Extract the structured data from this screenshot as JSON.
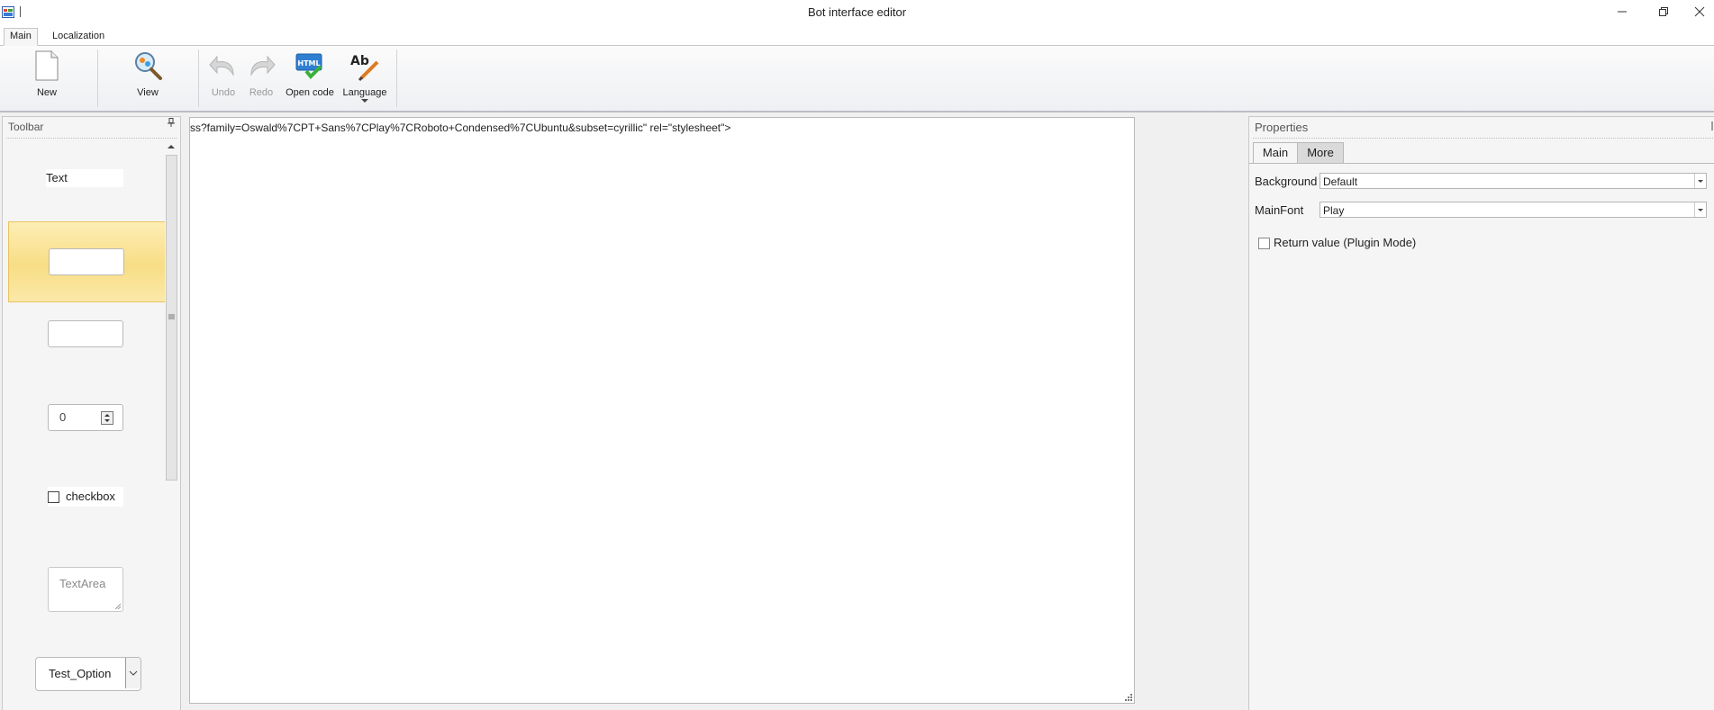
{
  "window": {
    "title": "Bot interface editor"
  },
  "ribbon_tabs": [
    {
      "label": "Main"
    },
    {
      "label": "Localization"
    }
  ],
  "ribbon": {
    "new_label": "New",
    "view_label": "View",
    "undo_label": "Undo",
    "redo_label": "Redo",
    "open_code_label": "Open code",
    "language_label": "Language"
  },
  "toolbar_panel": {
    "title": "Toolbar",
    "items": {
      "text_label": "Text",
      "number_value": "0",
      "checkbox_label": "checkbox",
      "textarea_placeholder": "TextArea",
      "select_value": "Test_Option"
    }
  },
  "editor": {
    "code_line": "ss?family=Oswald%7CPT+Sans%7CPlay%7CRoboto+Condensed%7CUbuntu&subset=cyrillic\" rel=\"stylesheet\">"
  },
  "properties": {
    "title": "Properties",
    "tabs": [
      {
        "label": "Main"
      },
      {
        "label": "More"
      }
    ],
    "background_label": "Background",
    "background_value": "Default",
    "mainfont_label": "MainFont",
    "mainfont_value": "Play",
    "return_value_label": "Return value (Plugin Mode)"
  }
}
